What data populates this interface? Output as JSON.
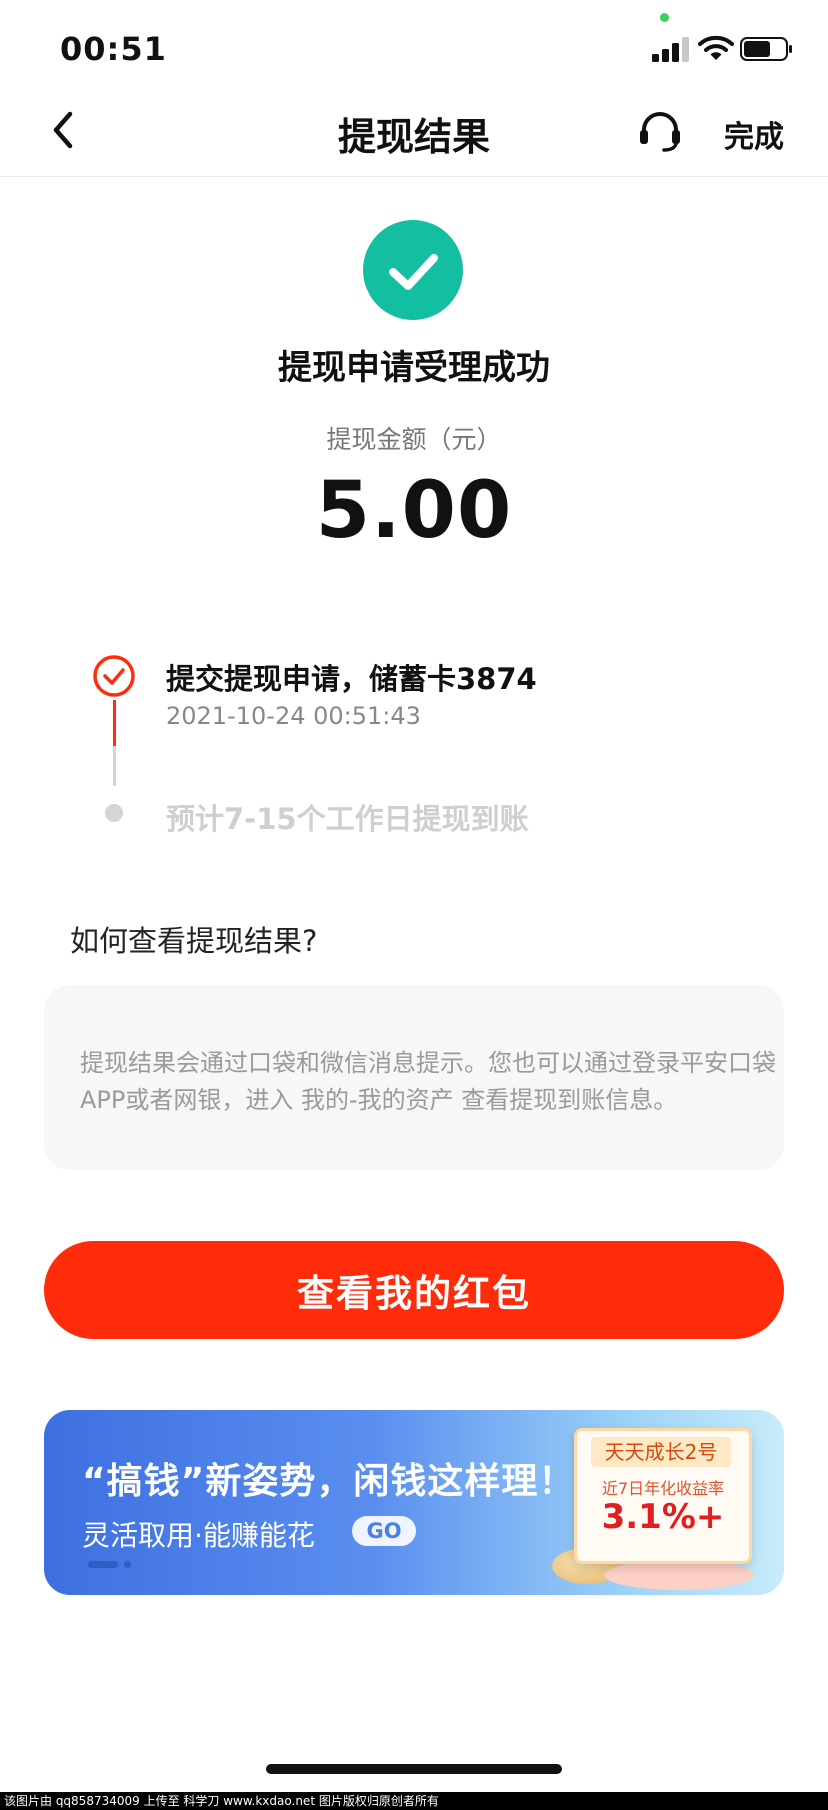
{
  "status_bar": {
    "time": "00:51"
  },
  "nav": {
    "title": "提现结果",
    "done_label": "完成"
  },
  "result": {
    "title": "提现申请受理成功",
    "amount_label": "提现金额（元）",
    "amount": "5.00"
  },
  "timeline": {
    "step1_title": "提交提现申请，储蓄卡3874",
    "step1_time": "2021-10-24 00:51:43",
    "step2_title": "预计7-15个工作日提现到账"
  },
  "help": {
    "title": "如何查看提现结果?",
    "text": "提现结果会通过口袋和微信消息提示。您也可以通过登录平安口袋APP或者网银，进入 我的-我的资产 查看提现到账信息。"
  },
  "main_button": {
    "label": "查看我的红包"
  },
  "banner": {
    "title": "“搞钱”新姿势，闲钱这样理！",
    "subtitle": "灵活取用·能赚能花",
    "go_label": "GO",
    "card_title": "天天成长2号",
    "card_subtitle": "近7日年化收益率",
    "card_rate": "3.1%+"
  },
  "watermark": "该图片由 qq858734009 上传至 科学刀 www.kxdao.net 图片版权归原创者所有",
  "colors": {
    "accent_red": "#ff2c0c",
    "success_green": "#13bfa0"
  }
}
